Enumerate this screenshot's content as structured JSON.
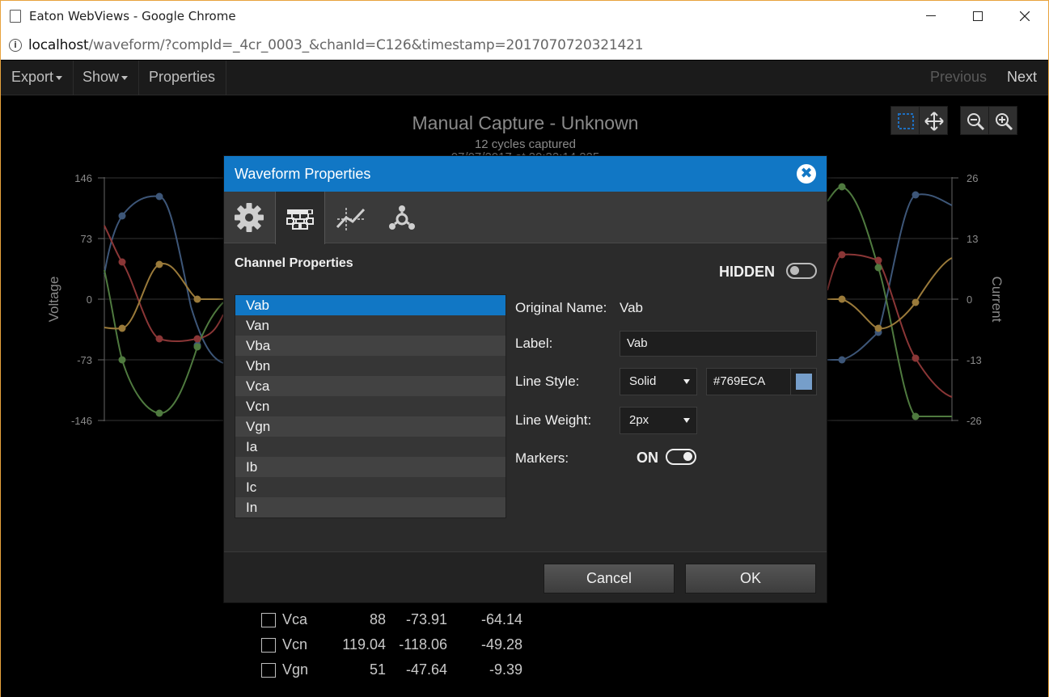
{
  "window": {
    "title": "Eaton WebViews - Google Chrome",
    "minimize": "—",
    "maximize": "☐",
    "close": "✕"
  },
  "address": {
    "host": "localhost",
    "path": "/waveform/?compId=_4cr_0003_&chanId=C126&timestamp=20170707203214​21"
  },
  "toolbar": {
    "export": "Export",
    "show": "Show",
    "properties": "Properties",
    "previous": "Previous",
    "next": "Next"
  },
  "chart": {
    "title": "Manual Capture - Unknown",
    "subtitle": "12 cycles captured",
    "subtitle2": "07/07/2017 at 20:32:14.225",
    "left_axis_label": "Voltage",
    "right_axis_label": "Current",
    "left_ticks": [
      "146",
      "73",
      "0",
      "-73",
      "-146"
    ],
    "right_ticks": [
      "26",
      "13",
      "0",
      "-13",
      "-26"
    ],
    "colors": {
      "blue": "#3d5678",
      "red": "#8a3636",
      "green": "#4f7a3f",
      "orange": "#9a7a3a"
    }
  },
  "chart_data": {
    "type": "line",
    "title": "Manual Capture - Unknown",
    "ylabel": "Voltage",
    "y2label": "Current",
    "ylim": [
      -146,
      146
    ],
    "y2lim": [
      -26,
      26
    ],
    "yticks": [
      146,
      73,
      0,
      -73,
      -146
    ],
    "y2ticks": [
      26,
      13,
      0,
      -13,
      -26
    ],
    "grid": true
  },
  "legend_rows": [
    {
      "name": "Vca",
      "a": "88",
      "b": "-73.91",
      "c": "-64.14"
    },
    {
      "name": "Vcn",
      "a": "119.04",
      "b": "-118.06",
      "c": "-49.28"
    },
    {
      "name": "Vgn",
      "a": "51",
      "b": "-47.64",
      "c": "-9.39"
    }
  ],
  "dialog": {
    "title": "Waveform Properties",
    "close_icon": "✖",
    "tabs": [
      "settings-gear-icon",
      "channel-tree-icon",
      "line-chart-icon",
      "network-icon"
    ],
    "section_title": "Channel Properties",
    "hidden_label": "HIDDEN",
    "hidden_on": false,
    "channels": [
      "Vab",
      "Van",
      "Vba",
      "Vbn",
      "Vca",
      "Vcn",
      "Vgn",
      "Ia",
      "Ib",
      "Ic",
      "In"
    ],
    "selected_channel": "Vab",
    "original_name_label": "Original Name:",
    "original_name": "Vab",
    "label_label": "Label:",
    "label_value": "Vab",
    "line_style_label": "Line Style:",
    "line_style": "Solid",
    "color_hex": "#769ECA",
    "line_weight_label": "Line Weight:",
    "line_weight": "2px",
    "markers_label": "Markers:",
    "markers_on_label": "ON",
    "markers_on": true,
    "cancel": "Cancel",
    "ok": "OK"
  }
}
